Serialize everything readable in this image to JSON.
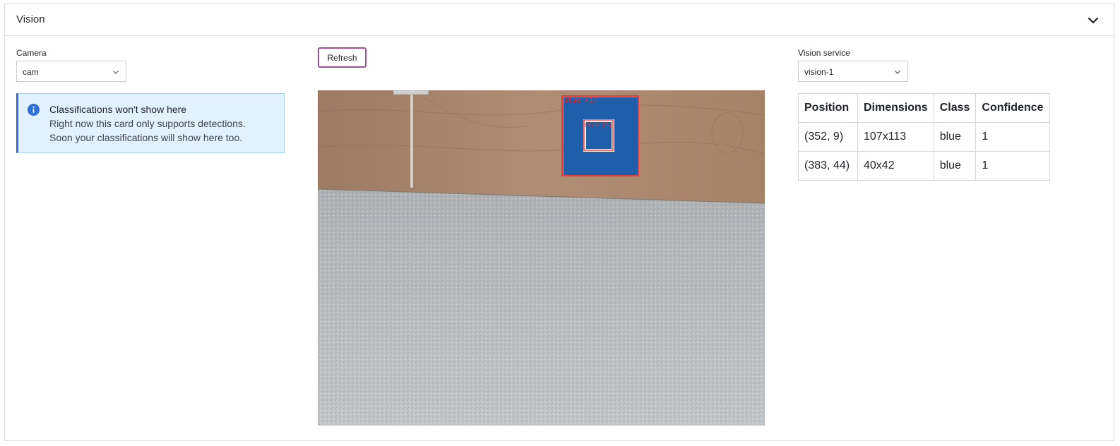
{
  "panel": {
    "title": "Vision",
    "collapse_icon": "chevron-down-icon"
  },
  "camera": {
    "label": "Camera",
    "selected": "cam"
  },
  "notice": {
    "icon": "info-icon",
    "title": "Classifications won't show here",
    "lines": [
      "Right now this card only supports detections.",
      "Soon your classifications will show here too."
    ]
  },
  "refresh": {
    "label": "Refresh"
  },
  "feed": {
    "overlay_labels": [
      "blue (1)",
      "blue (1)"
    ]
  },
  "vision_service": {
    "label": "Vision service",
    "selected": "vision-1"
  },
  "detections": {
    "headers": [
      "Position",
      "Dimensions",
      "Class",
      "Confidence"
    ],
    "rows": [
      [
        "(352, 9)",
        "107x113",
        "blue",
        "1"
      ],
      [
        "(383, 44)",
        "40x42",
        "blue",
        "1"
      ]
    ]
  },
  "colors": {
    "accent_purple": "#9c4f96",
    "info_blue": "#2e6fd8",
    "info_bg": "#e1f1fd",
    "detection_box": "#ff2020",
    "target_blue": "#1f5ea8"
  }
}
